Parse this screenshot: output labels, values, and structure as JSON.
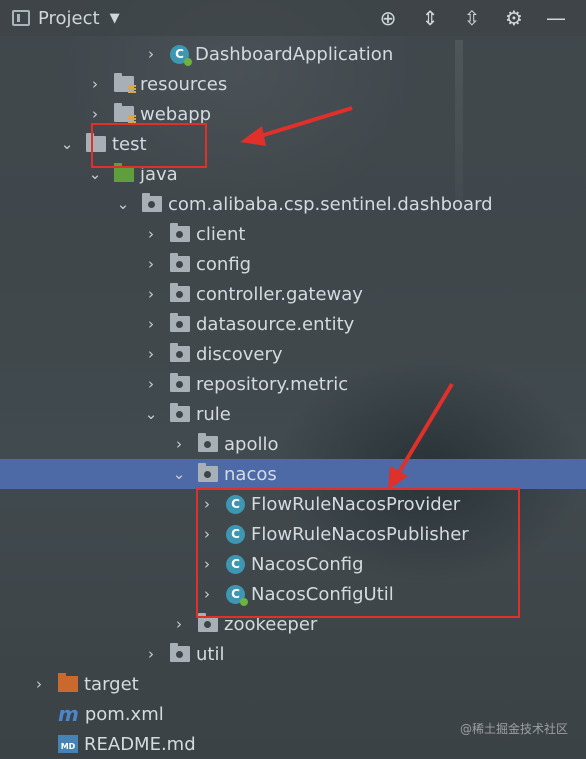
{
  "toolbar": {
    "title": "Project",
    "caret": "▼",
    "tools": [
      {
        "icon": "locate-icon",
        "glyph": "⊕"
      },
      {
        "icon": "expand-all-icon",
        "glyph": "⇕"
      },
      {
        "icon": "collapse-all-icon",
        "glyph": "⇳"
      },
      {
        "icon": "gear-icon",
        "glyph": "⚙"
      },
      {
        "icon": "minimize-icon",
        "glyph": "—"
      }
    ]
  },
  "tree": [
    {
      "label": "DashboardApplication",
      "level": 5,
      "arrow": "›",
      "icon": "spring-class"
    },
    {
      "label": "resources",
      "level": 3,
      "arrow": "›",
      "icon": "resources-folder"
    },
    {
      "label": "webapp",
      "level": 3,
      "arrow": "›",
      "icon": "resources-folder"
    },
    {
      "label": "test",
      "level": 2,
      "arrow": "⌄",
      "icon": "folder"
    },
    {
      "label": "java",
      "level": 3,
      "arrow": "⌄",
      "icon": "green-folder"
    },
    {
      "label": "com.alibaba.csp.sentinel.dashboard",
      "level": 4,
      "arrow": "⌄",
      "icon": "package"
    },
    {
      "label": "client",
      "level": 5,
      "arrow": "›",
      "icon": "package"
    },
    {
      "label": "config",
      "level": 5,
      "arrow": "›",
      "icon": "package"
    },
    {
      "label": "controller.gateway",
      "level": 5,
      "arrow": "›",
      "icon": "package"
    },
    {
      "label": "datasource.entity",
      "level": 5,
      "arrow": "›",
      "icon": "package"
    },
    {
      "label": "discovery",
      "level": 5,
      "arrow": "›",
      "icon": "package"
    },
    {
      "label": "repository.metric",
      "level": 5,
      "arrow": "›",
      "icon": "package"
    },
    {
      "label": "rule",
      "level": 5,
      "arrow": "⌄",
      "icon": "package"
    },
    {
      "label": "apollo",
      "level": 6,
      "arrow": "›",
      "icon": "package"
    },
    {
      "label": "nacos",
      "level": 6,
      "arrow": "⌄",
      "icon": "package",
      "selected": true
    },
    {
      "label": "FlowRuleNacosProvider",
      "level": 7,
      "arrow": "›",
      "icon": "class"
    },
    {
      "label": "FlowRuleNacosPublisher",
      "level": 7,
      "arrow": "›",
      "icon": "class"
    },
    {
      "label": "NacosConfig",
      "level": 7,
      "arrow": "›",
      "icon": "class"
    },
    {
      "label": "NacosConfigUtil",
      "level": 7,
      "arrow": "›",
      "icon": "spring-class"
    },
    {
      "label": "zookeeper",
      "level": 6,
      "arrow": "›",
      "icon": "package"
    },
    {
      "label": "util",
      "level": 5,
      "arrow": "›",
      "icon": "package"
    },
    {
      "label": "target",
      "level": 1,
      "arrow": "›",
      "icon": "orange-folder"
    },
    {
      "label": "pom.xml",
      "level": 1,
      "arrow": "",
      "icon": "maven"
    },
    {
      "label": "README.md",
      "level": 1,
      "arrow": "",
      "icon": "markdown"
    }
  ],
  "class_glyph": "C",
  "maven_glyph": "m",
  "md_glyph": "MD",
  "watermark": "@稀土掘金技术社区",
  "colors": {
    "selection": "#4d6aa6",
    "annotation": "#e0302a"
  }
}
